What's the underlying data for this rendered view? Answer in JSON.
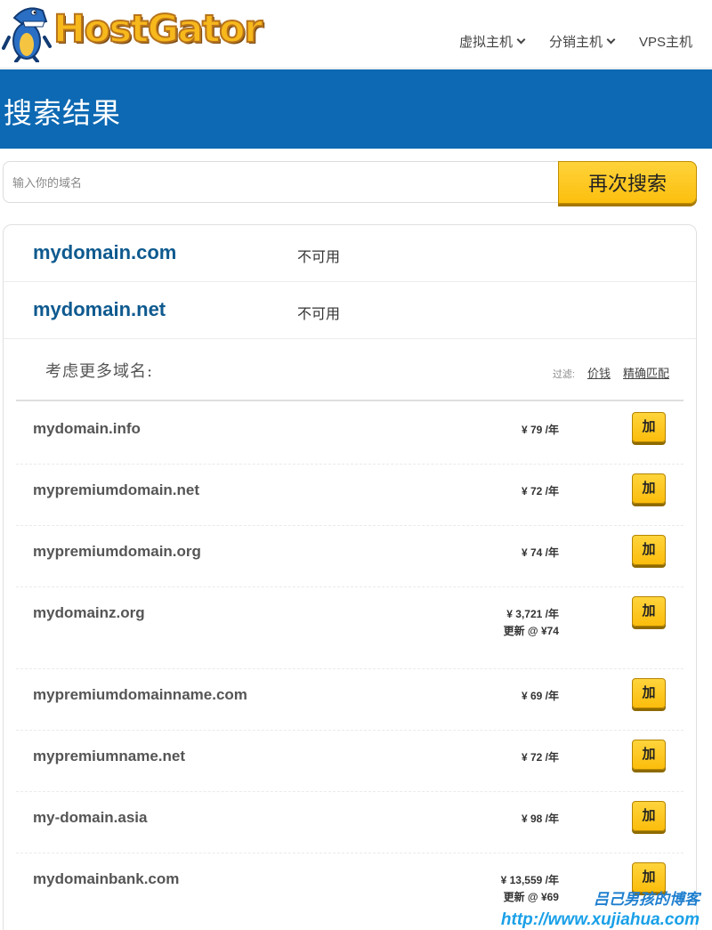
{
  "header": {
    "logo_text": "HostGator",
    "nav": [
      {
        "label": "虚拟主机",
        "has_dropdown": true
      },
      {
        "label": "分销主机",
        "has_dropdown": true
      },
      {
        "label": "VPS主机",
        "has_dropdown": false
      }
    ]
  },
  "banner": {
    "title": "搜索结果"
  },
  "search": {
    "placeholder": "输入你的域名",
    "value": "",
    "button_label": "再次搜索"
  },
  "taken": [
    {
      "domain": "mydomain.com",
      "status": "不可用"
    },
    {
      "domain": "mydomain.net",
      "status": "不可用"
    }
  ],
  "more": {
    "title": "考虑更多域名:",
    "filter_label": "过滤:",
    "filter_price": "价钱",
    "filter_exact": "精确匹配"
  },
  "add_label": "加",
  "suggestions": [
    {
      "domain": "mydomain.info",
      "price": "¥ 79 /年",
      "renew": ""
    },
    {
      "domain": "mypremiumdomain.net",
      "price": "¥ 72 /年",
      "renew": ""
    },
    {
      "domain": "mypremiumdomain.org",
      "price": "¥ 74 /年",
      "renew": ""
    },
    {
      "domain": "mydomainz.org",
      "price": "¥ 3,721 /年",
      "renew": "更新 @ ¥74"
    },
    {
      "domain": "mypremiumdomainname.com",
      "price": "¥ 69 /年",
      "renew": ""
    },
    {
      "domain": "mypremiumname.net",
      "price": "¥ 72 /年",
      "renew": ""
    },
    {
      "domain": "my-domain.asia",
      "price": "¥ 98 /年",
      "renew": ""
    },
    {
      "domain": "mydomainbank.com",
      "price": "¥ 13,559 /年",
      "renew": "更新 @ ¥69"
    }
  ],
  "watermark": {
    "line1": "吕己男孩的博客",
    "line2": "http://www.xujiahua.com"
  },
  "colors": {
    "brand_blue": "#0d69b3",
    "accent_yellow": "#fcbf0e",
    "domain_blue": "#0e5a8f"
  }
}
